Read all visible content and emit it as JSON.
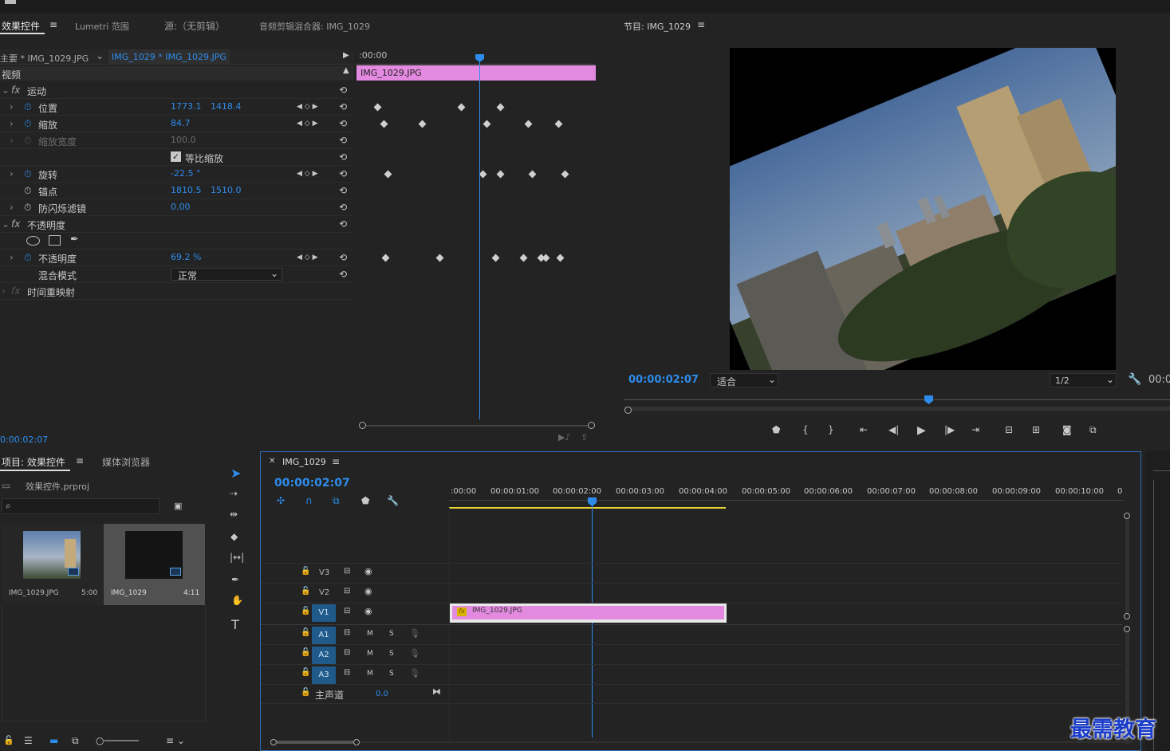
{
  "effect_controls": {
    "tabs": [
      "效果控件",
      "Lumetri 范围",
      "源:（无剪辑）",
      "音频剪辑混合器: IMG_1029"
    ],
    "master_label": "主要 * IMG_1029.JPG",
    "clip_selector": "IMG_1029 * IMG_1029.JPG",
    "ruler_start": ":00:00",
    "clip_bar": "IMG_1029.JPG",
    "section_video": "视频",
    "fx_motion": "运动",
    "position": {
      "label": "位置",
      "x": "1773.1",
      "y": "1418.4"
    },
    "scale": {
      "label": "缩放",
      "value": "84.7"
    },
    "scale_width": {
      "label": "缩放宽度",
      "value": "100.0"
    },
    "uniform_scale": "等比缩放",
    "rotation": {
      "label": "旋转",
      "value": "-22.5 °"
    },
    "anchor": {
      "label": "锚点",
      "x": "1810.5",
      "y": "1510.0"
    },
    "flicker": {
      "label": "防闪烁滤镜",
      "value": "0.00"
    },
    "fx_opacity": "不透明度",
    "opacity": {
      "label": "不透明度",
      "value": "69.2 %"
    },
    "blend": {
      "label": "混合模式",
      "value": "正常"
    },
    "fx_time_remap": "时间重映射",
    "timecode": "0:00:02:07"
  },
  "program": {
    "title": "节目: IMG_1029",
    "timecode": "00:00:02:07",
    "fit": "适合",
    "resolution": "1/2",
    "right_timecode": "00:0"
  },
  "project": {
    "tabs": [
      "项目: 效果控件",
      "媒体浏览器"
    ],
    "file": "效果控件.prproj",
    "items": [
      {
        "name": "IMG_1029.JPG",
        "duration": "5:00"
      },
      {
        "name": "IMG_1029",
        "duration": "4:11"
      }
    ]
  },
  "timeline": {
    "tab": "IMG_1029",
    "timecode": "00:00:02:07",
    "ruler": [
      ":00:00",
      "00:00:01:00",
      "00:00:02:00",
      "00:00:03:00",
      "00:00:04:00",
      "00:00:05:00",
      "00:00:06:00",
      "00:00:07:00",
      "00:00:08:00",
      "00:00:09:00",
      "00:00:10:00",
      "0"
    ],
    "video_tracks": [
      "V3",
      "V2",
      "V1"
    ],
    "audio_tracks": [
      "A1",
      "A2",
      "A3"
    ],
    "mute": "M",
    "solo": "S",
    "master": {
      "label": "主声道",
      "value": "0.0"
    },
    "clip": "IMG_1029.JPG",
    "fx_badge": "fx"
  },
  "watermark": "最需教育",
  "colors": {
    "accent": "#2d8ceb",
    "clip": "#e38ae0",
    "work_area": "#e8d432"
  }
}
